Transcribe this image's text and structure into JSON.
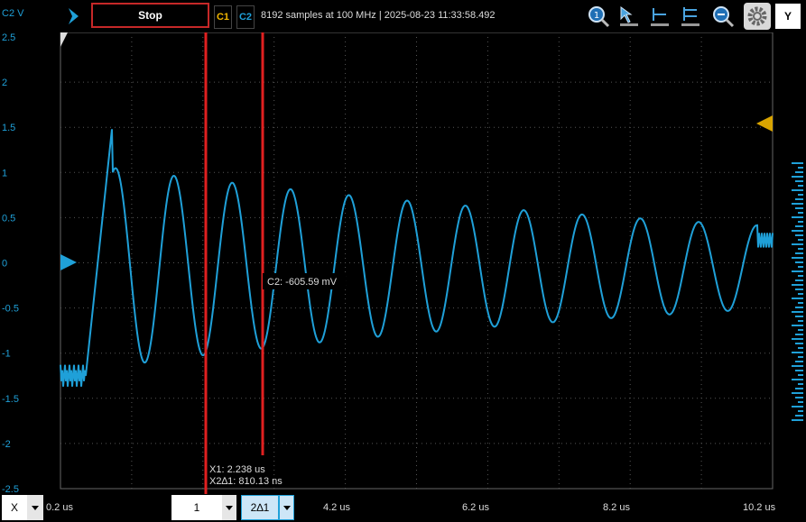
{
  "toolbar": {
    "channel_label": "C2 V",
    "stop_label": "Stop",
    "c1_label": "C1",
    "c2_label": "C2",
    "acq_info": "8192 samples at 100 MHz | 2025-08-23 11:33:58.492",
    "y_label": "Y",
    "icons": [
      "run-chevron-icon",
      "zoom-reset-icon",
      "cursor-arrow-icon",
      "horizontal-cursor-icon",
      "vertical-cursor-icon",
      "zoom-icon",
      "gear-icon"
    ]
  },
  "plot": {
    "y_ticks": [
      "2.5",
      "2",
      "1.5",
      "1",
      "0.5",
      "0",
      "-0.5",
      "-1",
      "-1.5",
      "-2",
      "-2.5"
    ],
    "cursor_value": "C2: -605.59 mV",
    "cursor_x1": "X1: 2.238 us",
    "cursor_dx": "X2∆1: 810.13 ns",
    "colors": {
      "trace": "#1fa0d8",
      "cursor": "#e02020",
      "trigger": "#d9a400",
      "grid": "#555555"
    }
  },
  "bottom": {
    "x_label": "X",
    "cursor_select": "1",
    "delta_select": "2∆1",
    "x_ticks": [
      "0.2 us",
      "4.2 us",
      "6.2 us",
      "8.2 us",
      "10.2 us"
    ]
  }
}
